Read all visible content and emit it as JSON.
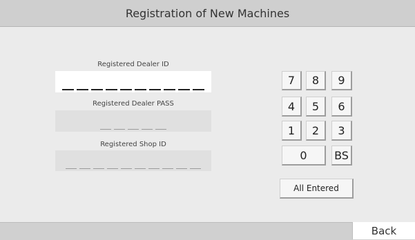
{
  "header": {
    "title": "Registration of New Machines"
  },
  "form": {
    "dealer_id": {
      "label": "Registered Dealer ID",
      "length": 10
    },
    "dealer_pass": {
      "label": "Registered Dealer PASS",
      "length": 5
    },
    "shop_id": {
      "label": "Registered Shop ID",
      "length": 10
    }
  },
  "keypad": {
    "keys": [
      "7",
      "8",
      "9",
      "4",
      "5",
      "6",
      "1",
      "2",
      "3",
      "0",
      "BS"
    ],
    "all_entered": "All Entered"
  },
  "footer": {
    "back_label": "Back"
  }
}
